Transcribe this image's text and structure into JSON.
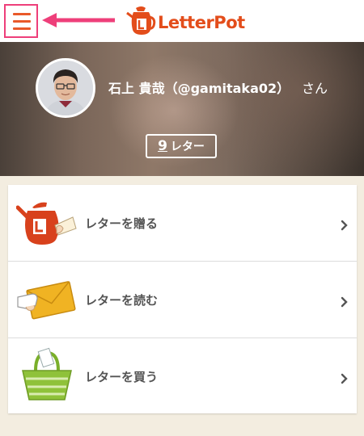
{
  "app": {
    "brand": "LetterPot",
    "colors": {
      "brand": "#e34d1b",
      "highlight": "#ee3f7a"
    }
  },
  "header": {
    "menu_icon": "hamburger-icon",
    "annotation_icon": "arrow-left-icon"
  },
  "profile": {
    "name": "石上 貴哉（@gamitaka02）",
    "honorific": "さん",
    "letter_count": "9",
    "letter_unit": "レター"
  },
  "menu": {
    "items": [
      {
        "label": "レターを贈る",
        "icon": "teapot-send-icon"
      },
      {
        "label": "レターを読む",
        "icon": "envelope-read-icon"
      },
      {
        "label": "レターを買う",
        "icon": "basket-buy-icon"
      }
    ]
  }
}
